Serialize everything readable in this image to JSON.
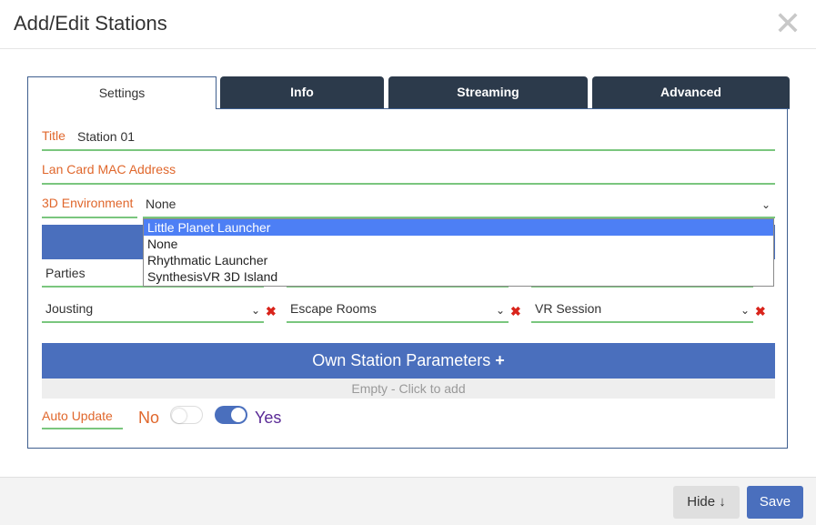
{
  "dialog": {
    "title": "Add/Edit Stations",
    "close_glyph": "✕"
  },
  "tabs": [
    {
      "label": "Settings"
    },
    {
      "label": "Info"
    },
    {
      "label": "Streaming"
    },
    {
      "label": "Advanced"
    }
  ],
  "fields": {
    "title": {
      "label": "Title",
      "value": "Station 01"
    },
    "mac": {
      "label": "Lan Card MAC Address",
      "value": ""
    },
    "env": {
      "label": "3D Environment",
      "value": "None"
    }
  },
  "env_dropdown": {
    "options": [
      "Little Planet Launcher",
      "None",
      "Rhythmatic Launcher",
      "SynthesisVR 3D Island"
    ],
    "highlighted": "Little Planet Launcher"
  },
  "categories": {
    "row1": [
      "Parties"
    ],
    "row2": [
      "Jousting",
      "Escape Rooms",
      "VR Session"
    ]
  },
  "own_params": {
    "label": "Own Station Parameters",
    "plus": "+",
    "empty": "Empty - Click to add"
  },
  "auto_update": {
    "label": "Auto Update",
    "no": "No",
    "yes": "Yes",
    "enabled": true
  },
  "footer": {
    "hide": "Hide ↓",
    "save": "Save"
  },
  "colors": {
    "accent": "#4a6fbd",
    "label": "#e0672c",
    "underline": "#7ac67e",
    "tab_dark": "#2c3a4b",
    "remove": "#d9241b"
  }
}
